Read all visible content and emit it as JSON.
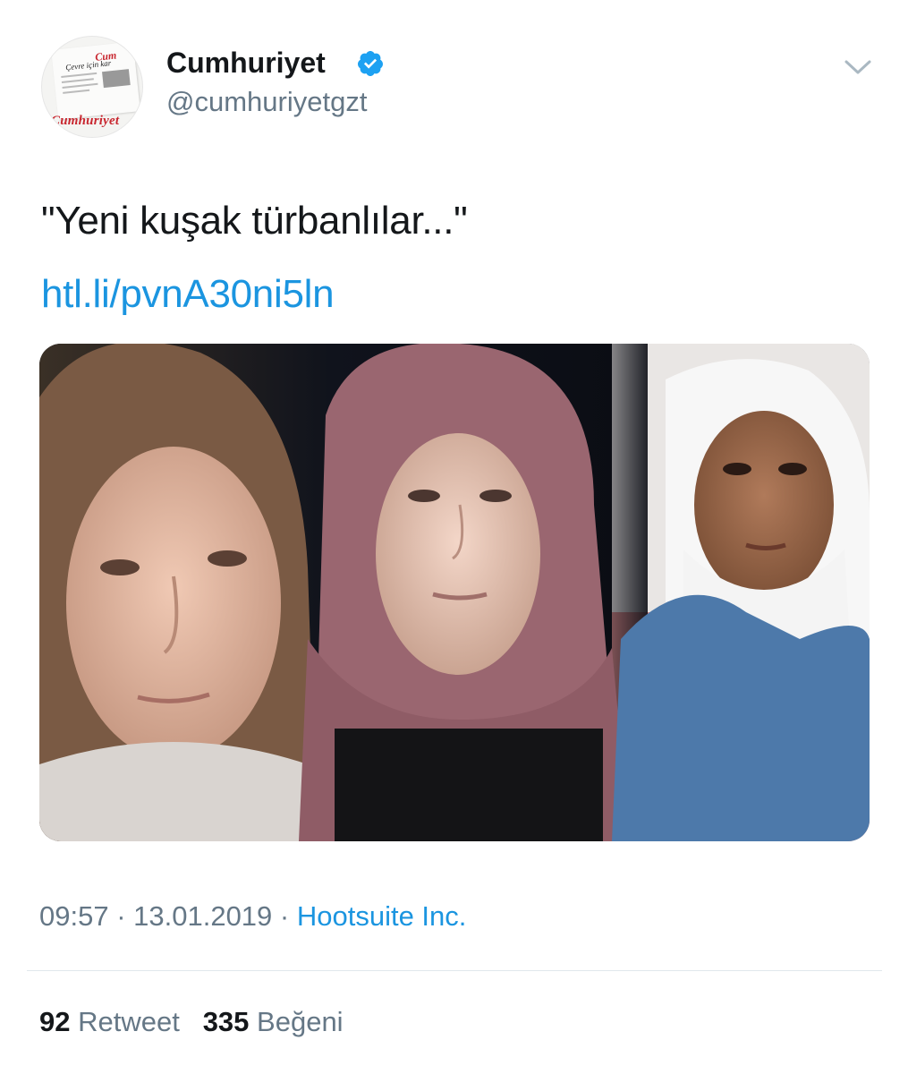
{
  "account": {
    "display_name": "Cumhuriyet",
    "handle": "@cumhuriyetgzt",
    "avatar_wordmark": "Cumhuriyet",
    "avatar_top_text": "Cum",
    "avatar_headline": "Çevre için kar",
    "verified_icon": "verified-badge-icon"
  },
  "tweet": {
    "text": "\"Yeni kuşak türbanlılar...\"",
    "link": "htl.li/pvnA30ni5ln"
  },
  "meta": {
    "time": "09:57",
    "separator1": " · ",
    "date": "13.01.2019",
    "separator2": " · ",
    "source": "Hootsuite Inc."
  },
  "stats": {
    "retweet_count": "92",
    "retweet_label": "Retweet",
    "like_count": "335",
    "like_label": "Beğeni"
  },
  "colors": {
    "link": "#1b95e0",
    "secondary_text": "#657786",
    "verified": "#1da1f2",
    "divider": "#e1e8ed"
  }
}
